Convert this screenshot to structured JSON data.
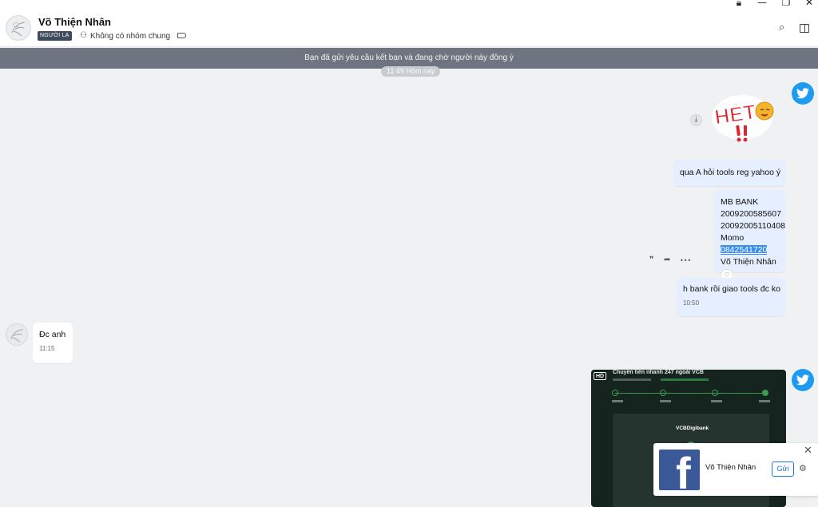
{
  "window": {
    "lock_icon": "lock-icon",
    "minimize": "—",
    "restore": "❐",
    "close": "✕"
  },
  "header": {
    "contact_name": "Võ Thiện Nhân",
    "badge": "NGƯỜI LẠ",
    "group_status": "Không có nhóm chung",
    "icons": [
      "search-icon",
      "sidebar-panel-icon",
      "tag-icon",
      "group-icon"
    ]
  },
  "banner": {
    "text": "Bạn đã gửi yêu cầu kết bạn và đang chờ người này đồng ý"
  },
  "time_divider": "11:49 Hôm nay",
  "messages": [
    {
      "from": "me",
      "text": "qua A hỏi tools reg yahoo ý"
    },
    {
      "from": "me",
      "lines": [
        "MB BANK",
        "2009200585607",
        "20092005110408",
        "Momo",
        "0842541720",
        "Võ Thiện Nhân"
      ],
      "highlighted": "0842541720"
    },
    {
      "from": "me",
      "text": "h bank rồi giao tools đc ko",
      "time": "10:50"
    },
    {
      "from": "them",
      "text": "Đc anh",
      "time": "11:15"
    }
  ],
  "message_actions": {
    "quote": "❞",
    "forward": "➦",
    "more": "•••",
    "react": "👍"
  },
  "video": {
    "badge": "HD",
    "title": "Chuyển tiền nhanh 247 ngoài VCB",
    "bank_label": "VCBDigibank"
  },
  "notification": {
    "name": "Võ Thiện Nhân",
    "send_label": "Gửi",
    "close": "✕",
    "gear": "⚙"
  },
  "colors": {
    "accent": "#1877f2",
    "mine_bubble": "#e5efff",
    "banner": "#6e7580",
    "twitter": "#1d9bf0",
    "facebook": "#3b5998"
  }
}
